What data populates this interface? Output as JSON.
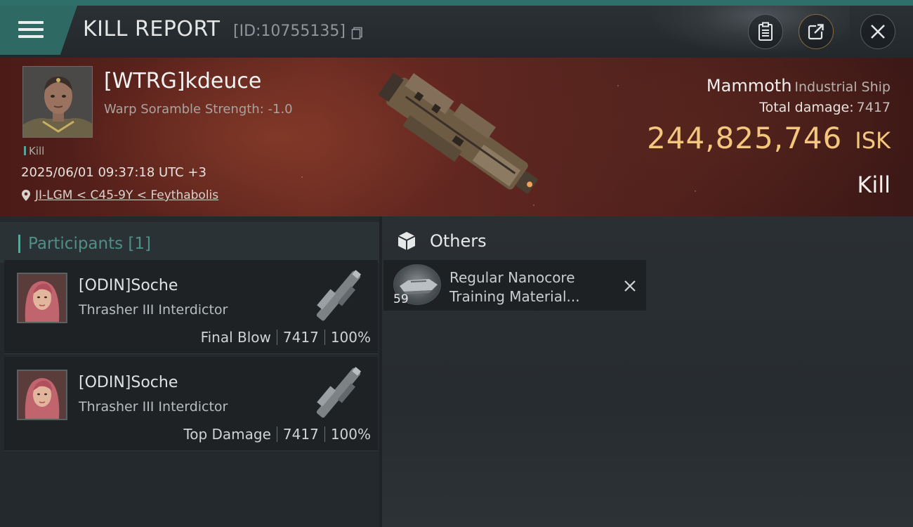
{
  "header": {
    "title": "KILL REPORT",
    "id_text": "[ID:10755135]"
  },
  "victim": {
    "name": "[WTRG]kdeuce",
    "subtitle": "Warp Soramble Strength: -1.0",
    "tag": "Kill",
    "timestamp": "2025/06/01 09:37:18 UTC +3",
    "location": "JI-LGM < C45-9Y < Feythabolis"
  },
  "ship": {
    "name": "Mammoth",
    "class": "Industrial Ship",
    "total_damage_label": "Total damage:",
    "total_damage_value": "7417",
    "isk_value": "244,825,746",
    "isk_unit": "ISK",
    "result": "Kill"
  },
  "participants": {
    "title": "Participants [1]",
    "items": [
      {
        "name": "[ODIN]Soche",
        "ship": "Thrasher III Interdictor",
        "role": "Final Blow",
        "damage": "7417",
        "percent": "100%"
      },
      {
        "name": "[ODIN]Soche",
        "ship": "Thrasher III Interdictor",
        "role": "Top Damage",
        "damage": "7417",
        "percent": "100%"
      }
    ]
  },
  "others": {
    "title": "Others",
    "items": [
      {
        "name_line1": "Regular Nanocore",
        "name_line2": "Training Material...",
        "quantity": "59"
      }
    ]
  },
  "colors": {
    "accent_teal": "#2e6a63",
    "isk_gold": "#f3c77e",
    "banner_red": "#6b2a22"
  },
  "icons": [
    "menu-icon",
    "copy-icon",
    "clipboard-icon",
    "share-icon",
    "close-icon",
    "location-pin-icon",
    "cube-icon",
    "remove-icon"
  ]
}
